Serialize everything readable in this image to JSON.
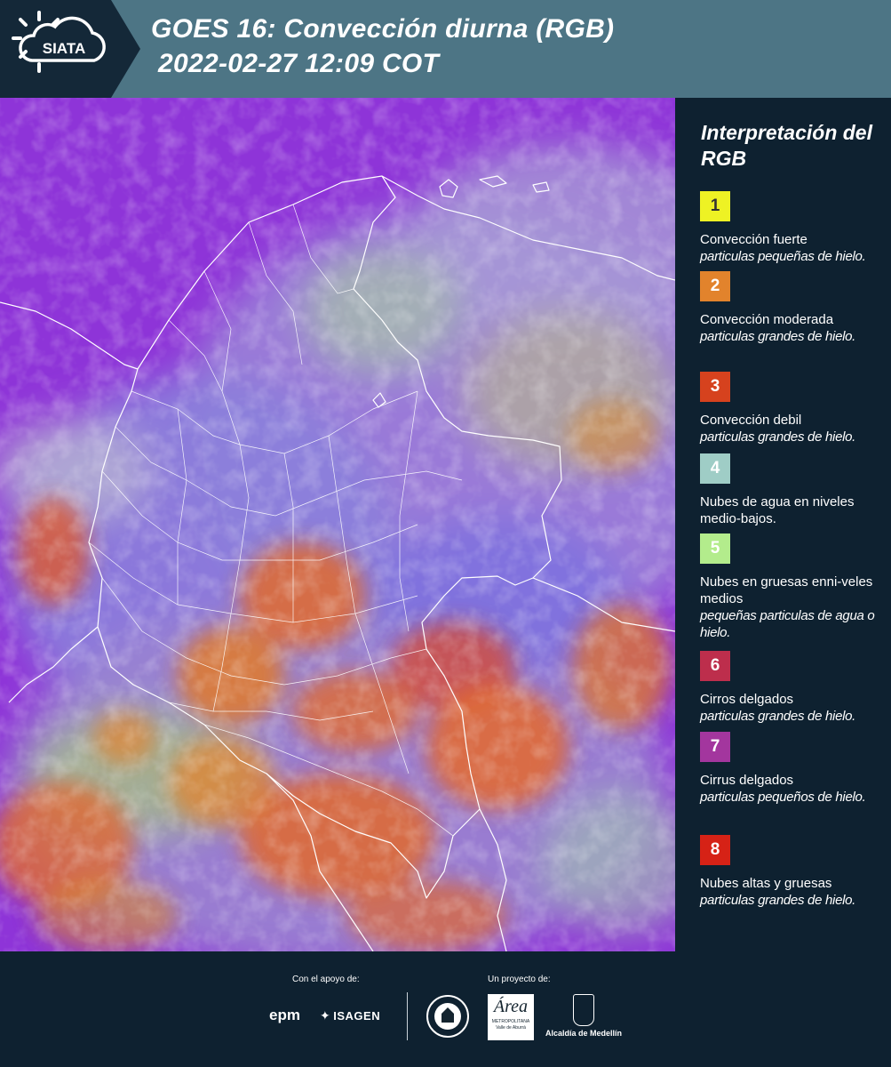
{
  "header": {
    "logo_text": "SIATA",
    "title_line1": "GOES 16: Convección diurna (RGB)",
    "title_line2": "2022-02-27 12:09 COT"
  },
  "map": {
    "content": "GOES-16 daytime convection RGB satellite image over Colombia with white administrative boundaries",
    "colors": {
      "background_magenta": "#8e34d8",
      "convection_orange": "#e06a30",
      "low_clouds": "#9fc9b8",
      "mid_clouds": "#b9d879",
      "violet_cloud": "#7a6fe0"
    }
  },
  "legend": {
    "title": "Interpretación del RGB",
    "items": [
      {
        "num": "1",
        "color": "#eef224",
        "text_color": "#333333",
        "label": "Convección fuerte",
        "desc": "particulas pequeñas de hielo."
      },
      {
        "num": "2",
        "color": "#e2832c",
        "text_color": "#ffffff",
        "label": "Convección moderada",
        "desc": "particulas grandes de hielo."
      },
      {
        "num": "3",
        "color": "#d6421e",
        "text_color": "#ffffff",
        "label": "Convección debil",
        "desc": "particulas grandes de hielo."
      },
      {
        "num": "4",
        "color": "#9fcdc6",
        "text_color": "#ffffff",
        "label": "Nubes de agua en niveles medio-bajos.",
        "desc": ""
      },
      {
        "num": "5",
        "color": "#b3ec8c",
        "text_color": "#ffffff",
        "label": "Nubes en gruesas enni-veles medios",
        "desc": "pequeñas particulas de agua o hielo."
      },
      {
        "num": "6",
        "color": "#bd2e4c",
        "text_color": "#ffffff",
        "label": "Cirros delgados",
        "desc": "particulas grandes de hielo."
      },
      {
        "num": "7",
        "color": "#a3369e",
        "text_color": "#ffffff",
        "label": "Cirrus delgados",
        "desc": "particulas pequeños de hielo."
      },
      {
        "num": "8",
        "color": "#d62216",
        "text_color": "#ffffff",
        "label": "Nubes altas y gruesas",
        "desc": "particulas grandes de hielo."
      }
    ]
  },
  "footer": {
    "support_label": "Con el apoyo de:",
    "project_label": "Un proyecto de:",
    "sponsors": [
      "epm",
      "ISAGEN"
    ],
    "partners": {
      "area_logo_big": "Área",
      "area_logo_small1": "METROPOLITANA",
      "area_logo_small2": "Valle de Aburrá",
      "alcaldia": "Alcaldía de Medellín"
    }
  }
}
